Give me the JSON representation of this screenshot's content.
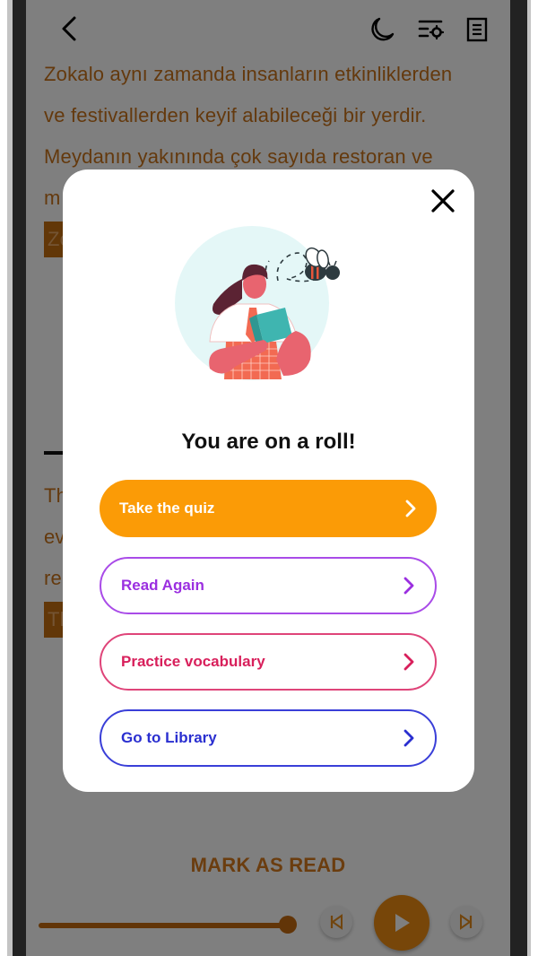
{
  "app": {
    "topbar": {
      "back_icon": "chevron-left-icon",
      "dark_mode_icon": "moon-icon",
      "reading_settings_icon": "text-settings-icon",
      "table_of_contents_icon": "document-list-icon"
    },
    "article": {
      "lines": [
        "Zokalo aynı zamanda insanların etkinliklerden",
        "ve festivallerden keyif alabileceği bir yerdir.",
        "Meydanın yakınında çok sayıda restoran ve",
        "m"
      ],
      "highlight_1": "Zo",
      "lines_2": [
        "Th",
        "ev",
        "re"
      ],
      "highlight_2": "Th"
    },
    "footer": {
      "mark_as_read": "MARK AS READ",
      "audio_progress": 1.0,
      "prev_icon": "skip-back-icon",
      "play_icon": "play-icon",
      "next_icon": "skip-forward-icon"
    }
  },
  "modal": {
    "close_icon": "close-icon",
    "illustration": "woman-reading-with-bee",
    "title": "You are on a roll!",
    "actions": [
      {
        "label": "Take the quiz",
        "color": "#fb9b06"
      },
      {
        "label": "Read Again",
        "color": "#9b2fe0"
      },
      {
        "label": "Practice vocabulary",
        "color": "#d81f5b"
      },
      {
        "label": "Go to Library",
        "color": "#2a2fd0"
      }
    ]
  },
  "colors": {
    "accent": "#fb9b06",
    "article_text": "#f08a1e",
    "overlay": "rgba(0,0,0,0.5)"
  }
}
